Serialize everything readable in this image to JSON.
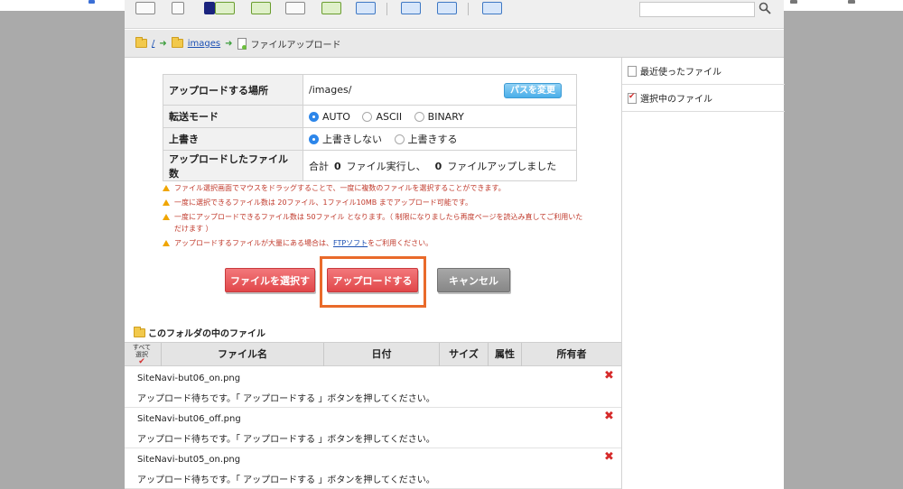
{
  "breadcrumb": {
    "root": "/",
    "folder": "images",
    "current": "ファイルアップロード"
  },
  "settings": {
    "location_label": "アップロードする場所",
    "location_value": "/images/",
    "change_path_button": "パスを変更",
    "mode_label": "転送モード",
    "mode_options": [
      "AUTO",
      "ASCII",
      "BINARY"
    ],
    "mode_selected": "AUTO",
    "overwrite_label": "上書き",
    "overwrite_options": [
      "上書きしない",
      "上書きする"
    ],
    "overwrite_selected": "上書きしない",
    "count_label": "アップロードしたファイル数",
    "count_prefix": "合計",
    "count_executed": "0",
    "count_executed_suffix": "ファイル実行し、",
    "count_uploaded": "0",
    "count_uploaded_suffix": "ファイルアップしました"
  },
  "notes": [
    "ファイル選択画面でマウスをドラッグすることで、一度に複数のファイルを選択することができます。",
    "一度に選択できるファイル数は 20ファイル、1ファイル10MB までアップロード可能です。",
    "一度にアップロードできるファイル数は 50ファイル となります。（ 制限になりましたら再度ページを読込み直してご利用いただけます ）"
  ],
  "note_ftp": {
    "before": "アップロードするファイルが大量にある場合は、",
    "link": "FTPソフト",
    "after": "をご利用ください。"
  },
  "buttons": {
    "select": "ファイルを選択する",
    "upload": "アップロードする",
    "cancel": "キャンセル"
  },
  "files": {
    "title": "このフォルダの中のファイル",
    "select_all": [
      "すべて",
      "選択"
    ],
    "columns": [
      "ファイル名",
      "日付",
      "サイズ",
      "属性",
      "所有者"
    ],
    "rows": [
      {
        "name": "SiteNavi-but06_on.png",
        "status": "アップロード待ちです。「 アップロードする 」ボタンを押してください。"
      },
      {
        "name": "SiteNavi-but06_off.png",
        "status": "アップロード待ちです。「 アップロードする 」ボタンを押してください。"
      },
      {
        "name": "SiteNavi-but05_on.png",
        "status": "アップロード待ちです。「 アップロードする 」ボタンを押してください。"
      }
    ]
  },
  "sidebar": {
    "recent": "最近使ったファイル",
    "selected": "選択中のファイル"
  },
  "colors": {
    "accent_red": "#e1474a",
    "highlight_orange": "#e96a2a",
    "path_button_blue": "#4aaee9",
    "warning_text": "#c0392b"
  },
  "icons": {
    "delete": "close-x-icon",
    "warning": "warning-triangle-icon",
    "folder": "folder-icon",
    "document": "document-icon"
  }
}
